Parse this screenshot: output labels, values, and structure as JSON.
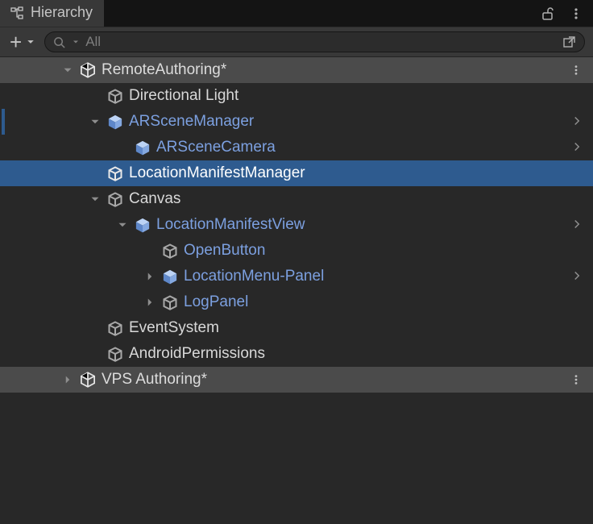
{
  "panel": {
    "title": "Hierarchy"
  },
  "search": {
    "placeholder": "All",
    "value": ""
  },
  "scenes": [
    {
      "name": "RemoteAuthoring*",
      "expanded": true,
      "children": [
        {
          "name": "Directional Light",
          "type": "go",
          "depth": 0
        },
        {
          "name": "ARSceneManager",
          "type": "prefab",
          "depth": 0,
          "expanded": true,
          "overrides": true,
          "ancestor": true
        },
        {
          "name": "ARSceneCamera",
          "type": "prefab",
          "depth": 1,
          "overrides": true
        },
        {
          "name": "LocationManifestManager",
          "type": "go",
          "depth": 0,
          "selected": true
        },
        {
          "name": "Canvas",
          "type": "go",
          "depth": 0,
          "expanded": true
        },
        {
          "name": "LocationManifestView",
          "type": "prefab",
          "depth": 1,
          "expanded": true,
          "overrides": true
        },
        {
          "name": "OpenButton",
          "type": "prefab-child",
          "depth": 2
        },
        {
          "name": "LocationMenu-Panel",
          "type": "prefab",
          "depth": 2,
          "collapsed": true,
          "overrides": true
        },
        {
          "name": "LogPanel",
          "type": "prefab-child",
          "depth": 2,
          "collapsed": true
        },
        {
          "name": "EventSystem",
          "type": "go",
          "depth": 0
        },
        {
          "name": "AndroidPermissions",
          "type": "go",
          "depth": 0
        }
      ]
    },
    {
      "name": "VPS Authoring*",
      "expanded": false,
      "children": []
    }
  ]
}
